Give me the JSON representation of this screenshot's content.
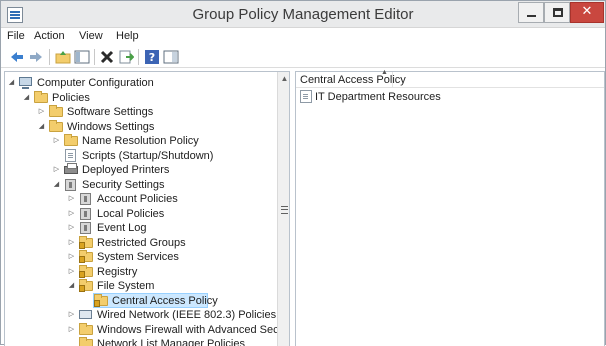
{
  "window": {
    "title": "Group Policy Management Editor",
    "close_glyph": "✕"
  },
  "menu": {
    "items": [
      "File",
      "Action",
      "View",
      "Help"
    ]
  },
  "toolbar": {
    "buttons": [
      {
        "name": "back-arrow-icon",
        "color": "#3b7fcf"
      },
      {
        "name": "forward-arrow-icon",
        "color": "#3b7fcf"
      },
      {
        "name": "up-folder-icon",
        "color": "#d9a321"
      },
      {
        "name": "show-hide-tree-icon",
        "color": "#5f6f7f"
      },
      {
        "name": "delete-x-icon",
        "color": "#2b2b2b"
      },
      {
        "name": "export-list-icon",
        "color": "#4aa046"
      },
      {
        "name": "help-icon",
        "color": "#3c64b4"
      },
      {
        "name": "properties-view-icon",
        "color": "#5f6f7f"
      }
    ]
  },
  "tree": {
    "nodes": [
      {
        "label": "Computer Configuration",
        "expander": "◢",
        "icon": "computer"
      },
      {
        "label": "Policies",
        "expander": "◢",
        "icon": "folder"
      },
      {
        "label": "Software Settings",
        "expander": "▷",
        "icon": "folder"
      },
      {
        "label": "Windows Settings",
        "expander": "◢",
        "icon": "folder"
      },
      {
        "label": "Name Resolution Policy",
        "expander": "▷",
        "icon": "folder"
      },
      {
        "label": "Scripts (Startup/Shutdown)",
        "expander": "",
        "icon": "doc"
      },
      {
        "label": "Deployed Printers",
        "expander": "▷",
        "icon": "printer"
      },
      {
        "label": "Security Settings",
        "expander": "◢",
        "icon": "safe"
      },
      {
        "label": "Account Policies",
        "expander": "▷",
        "icon": "safe"
      },
      {
        "label": "Local Policies",
        "expander": "▷",
        "icon": "safe"
      },
      {
        "label": "Event Log",
        "expander": "▷",
        "icon": "safe"
      },
      {
        "label": "Restricted Groups",
        "expander": "▷",
        "icon": "lockfolder"
      },
      {
        "label": "System Services",
        "expander": "▷",
        "icon": "lockfolder"
      },
      {
        "label": "Registry",
        "expander": "▷",
        "icon": "lockfolder"
      },
      {
        "label": "File System",
        "expander": "◢",
        "icon": "lockfolder"
      },
      {
        "label": "Central Access Policy",
        "expander": "",
        "icon": "lockfolder"
      },
      {
        "label": "Wired Network (IEEE 802.3) Policies",
        "expander": "▷",
        "icon": "network"
      },
      {
        "label": "Windows Firewall with Advanced Securit",
        "expander": "▷",
        "icon": "folder"
      },
      {
        "label": "Network List Manager Policies",
        "expander": "",
        "icon": "folder"
      }
    ],
    "selected_label": "Central Access Policy"
  },
  "details": {
    "column_header": "Central Access Policy",
    "items": [
      "IT Department Resources"
    ]
  },
  "colors": {
    "selection": "#cce8ff",
    "close_button": "#c9473f",
    "folder": "#f3cd6c"
  }
}
